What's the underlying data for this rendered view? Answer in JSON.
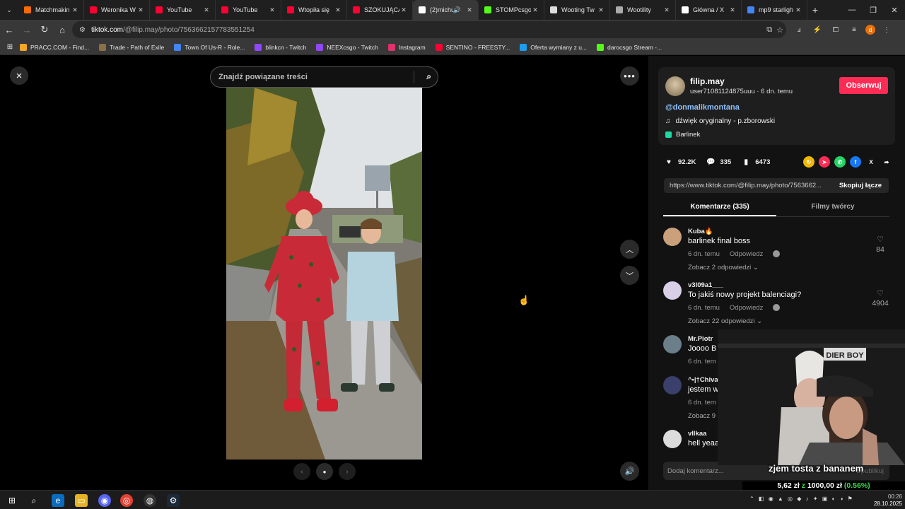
{
  "browser": {
    "tabs": [
      {
        "title": "Matchmakin",
        "color": "#ff6a00"
      },
      {
        "title": "Weronika W",
        "color": "#ff0033"
      },
      {
        "title": "YouTube",
        "color": "#ff0033"
      },
      {
        "title": "YouTube",
        "color": "#ff0033"
      },
      {
        "title": "Wtopiła się",
        "color": "#ff0033"
      },
      {
        "title": "SZOKUJĄCA",
        "color": "#ff0033"
      },
      {
        "title": "(2)michu",
        "color": "#ffffff",
        "active": true
      },
      {
        "title": "STOMPcsgo",
        "color": "#53fc18"
      },
      {
        "title": "Wooting Tw",
        "color": "#dddddd"
      },
      {
        "title": "Wootility",
        "color": "#aaaaaa"
      },
      {
        "title": "Główna / X",
        "color": "#ffffff"
      },
      {
        "title": "mp9 starligh",
        "color": "#4285f4"
      }
    ],
    "new_tab": "+",
    "url_host": "tiktok.com",
    "url_path": "/@filip.may/photo/7563662157783551254",
    "bookmarks": [
      {
        "label": "PRACC.COM - Find...",
        "color": "#f5a623"
      },
      {
        "label": "Trade - Path of Exile",
        "color": "#8b6f47"
      },
      {
        "label": "Town Of Us-R - Role...",
        "color": "#4285f4"
      },
      {
        "label": "blinkcn - Twitch",
        "color": "#9146ff"
      },
      {
        "label": "NEEXcsgo - Twitch",
        "color": "#9146ff"
      },
      {
        "label": "Instagram",
        "color": "#e1306c"
      },
      {
        "label": "SENTINO - FREESTY...",
        "color": "#ff0033"
      },
      {
        "label": "Oferta wymiany z u...",
        "color": "#1b9df0"
      },
      {
        "label": "darocsgo Stream -...",
        "color": "#53fc18"
      }
    ]
  },
  "viewer": {
    "search_placeholder": "Znajdź powiązane treści",
    "close_icon": "×",
    "more_icon": "•••",
    "up_icon": "︿",
    "down_icon": "﹀",
    "prev_icon": "‹",
    "next_icon": "›",
    "dot_icon": "●",
    "volume_icon": "🔊"
  },
  "post": {
    "username": "filip.may",
    "sub": "user7108112487​5uuu · 6 dn. temu",
    "follow_label": "Obserwuj",
    "mention": "@donmalikmontana",
    "sound": "dźwięk oryginalny - p.zborowski",
    "place": "Barlinek",
    "likes": "92.2K",
    "comments": "335",
    "saves": "6473",
    "link": "https://www.tiktok.com/@filip.may/photo/7563662...",
    "copy_label": "Skopiuj łącze",
    "tab_comments": "Komentarze (335)",
    "tab_creator": "Filmy twórcy"
  },
  "comments": [
    {
      "user": "Kuba🔥",
      "text": "barlinek final boss",
      "time": "6 dn. temu",
      "reply": "Odpowiedz",
      "more": "Zobacz 2 odpowiedzi ⌄",
      "likes": "84",
      "avatar": "#c9a07a"
    },
    {
      "user": "v3l09a1___",
      "text": "To jakiś nowy projekt balenciagi?",
      "time": "6 dn. temu",
      "reply": "Odpowiedz",
      "more": "Zobacz 22 odpowiedzi ⌄",
      "likes": "4904",
      "avatar": "#d9d0e8"
    },
    {
      "user": "Mr.Piotr",
      "text": "Joooo B",
      "time": "6 dn. tem",
      "reply": "",
      "more": "",
      "likes": "",
      "avatar": "#6a7f8a"
    },
    {
      "user": "^•|†Chiva",
      "text": "jestem w",
      "time": "6 dn. tem",
      "reply": "",
      "more": "Zobacz 9",
      "likes": "",
      "avatar": "#3b3f6b"
    },
    {
      "user": "vllkaa",
      "text": "hell yeaa",
      "time": "",
      "reply": "",
      "more": "",
      "likes": "",
      "avatar": "#dcdcdc"
    }
  ],
  "comment_input": {
    "placeholder": "Dodaj komentarz...",
    "publish": "Opublikuj"
  },
  "stream": {
    "overlay_text": "zjem tosta z bananem",
    "donation_prefix": "5,62 zł",
    "donation_sep": "z",
    "donation_goal": "1000,00 zł",
    "donation_pct": "(0.56%)",
    "hat_text": "DIER BOY"
  },
  "taskbar": {
    "clock_time": "00:26",
    "clock_date": "28.10.2025"
  }
}
